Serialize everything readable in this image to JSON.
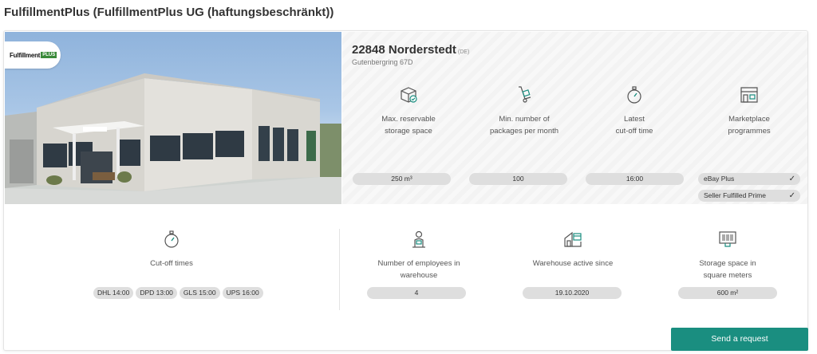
{
  "page": {
    "title": "FulfillmentPlus (FulfillmentPlus UG (haftungsbeschränkt))"
  },
  "photo": {
    "logo_text": "Fulfillment",
    "logo_plus": "PLUS"
  },
  "location": {
    "city": "22848 Norderstedt",
    "country": "(DE)",
    "street": "Gutenbergring 67D"
  },
  "features": [
    {
      "label_line1": "Max. reservable",
      "label_line2": "storage space",
      "value": "250 m³",
      "icon": "box-check-icon"
    },
    {
      "label_line1": "Min. number of",
      "label_line2": "packages per month",
      "value": "100",
      "icon": "hand-truck-icon"
    },
    {
      "label_line1": "Latest",
      "label_line2": "cut-off time",
      "value": "16:00",
      "icon": "stopwatch-icon"
    },
    {
      "label_line1": "Marketplace",
      "label_line2": "programmes",
      "icon": "storefront-icon",
      "programmes": [
        "eBay Plus",
        "Seller Fulfilled Prime"
      ]
    }
  ],
  "cutoff": {
    "label": "Cut-off times",
    "icon": "stopwatch-icon",
    "chips": [
      "DHL 14:00",
      "DPD 13:00",
      "GLS 15:00",
      "UPS 16:00"
    ]
  },
  "stats": [
    {
      "label_line1": "Number of employees in",
      "label_line2": "warehouse",
      "value": "4",
      "icon": "worker-icon"
    },
    {
      "label_line1": "Warehouse active since",
      "label_line2": "",
      "value": "19.10.2020",
      "icon": "warehouse-calendar-icon"
    },
    {
      "label_line1": "Storage space in",
      "label_line2": "square meters",
      "value": "600 m²",
      "icon": "barcode-icon"
    }
  ],
  "actions": {
    "send_request": "Send a request"
  },
  "colors": {
    "accent": "#1a8e80",
    "pill": "#dedede"
  }
}
